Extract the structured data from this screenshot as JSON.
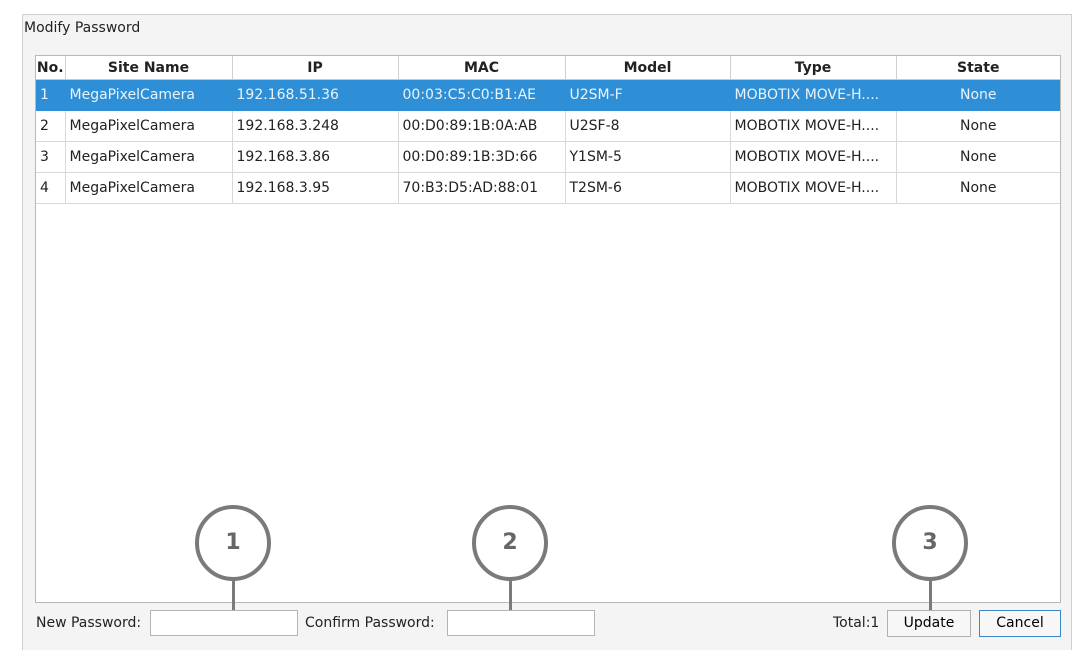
{
  "window": {
    "title": "Modify Password"
  },
  "table": {
    "columns": [
      "No.",
      "Site Name",
      "IP",
      "MAC",
      "Model",
      "Type",
      "State"
    ],
    "rows": [
      {
        "no": "1",
        "site_name": "MegaPixelCamera",
        "ip": "192.168.51.36",
        "mac": "00:03:C5:C0:B1:AE",
        "model": "U2SM-F",
        "type": "MOBOTIX MOVE-H....",
        "state": "None",
        "selected": true
      },
      {
        "no": "2",
        "site_name": "MegaPixelCamera",
        "ip": "192.168.3.248",
        "mac": "00:D0:89:1B:0A:AB",
        "model": "U2SF-8",
        "type": "MOBOTIX MOVE-H....",
        "state": "None",
        "selected": false
      },
      {
        "no": "3",
        "site_name": "MegaPixelCamera",
        "ip": "192.168.3.86",
        "mac": "00:D0:89:1B:3D:66",
        "model": "Y1SM-5",
        "type": "MOBOTIX MOVE-H....",
        "state": "None",
        "selected": false
      },
      {
        "no": "4",
        "site_name": "MegaPixelCamera",
        "ip": "192.168.3.95",
        "mac": "70:B3:D5:AD:88:01",
        "model": "T2SM-6",
        "type": "MOBOTIX MOVE-H....",
        "state": "None",
        "selected": false
      }
    ]
  },
  "form": {
    "new_password_label": "New Password:",
    "new_password_value": "",
    "confirm_password_label": "Confirm Password:",
    "confirm_password_value": "",
    "total_label": "Total:1",
    "update_label": "Update",
    "cancel_label": "Cancel"
  },
  "callouts": [
    "1",
    "2",
    "3"
  ],
  "colors": {
    "selection": "#2f8fd6",
    "callout": "#7a7a7a"
  }
}
